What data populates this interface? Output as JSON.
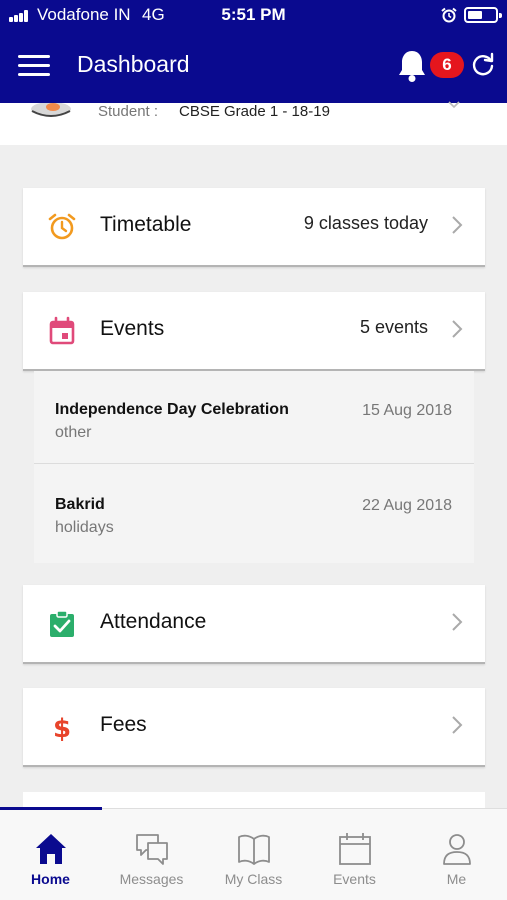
{
  "status_bar": {
    "carrier": "Vodafone IN",
    "network": "4G",
    "time": "5:51 PM"
  },
  "header": {
    "title": "Dashboard",
    "notification_count": "6"
  },
  "student": {
    "label": "Student :",
    "value": "CBSE Grade 1 - 18-19"
  },
  "cards": {
    "timetable": {
      "title": "Timetable",
      "meta": "9 classes today"
    },
    "events": {
      "title": "Events",
      "meta": "5 events"
    },
    "attendance": {
      "title": "Attendance"
    },
    "fees": {
      "title": "Fees"
    }
  },
  "events": [
    {
      "name": "Independence Day Celebration",
      "type": "other",
      "date": "15 Aug 2018"
    },
    {
      "name": "Bakrid",
      "type": "holidays",
      "date": "22 Aug 2018"
    }
  ],
  "bottom_nav": [
    {
      "label": "Home",
      "icon": "home-icon",
      "active": true
    },
    {
      "label": "Messages",
      "icon": "messages-icon",
      "active": false
    },
    {
      "label": "My Class",
      "icon": "book-icon",
      "active": false
    },
    {
      "label": "Events",
      "icon": "calendar-icon",
      "active": false
    },
    {
      "label": "Me",
      "icon": "person-icon",
      "active": false
    }
  ],
  "colors": {
    "brand": "#0a0a8f",
    "badge": "#e5161d",
    "timetable_icon": "#f29a1f",
    "events_icon": "#e04a7a",
    "attendance_icon": "#2bae6b",
    "fees_icon": "#e8442b"
  }
}
